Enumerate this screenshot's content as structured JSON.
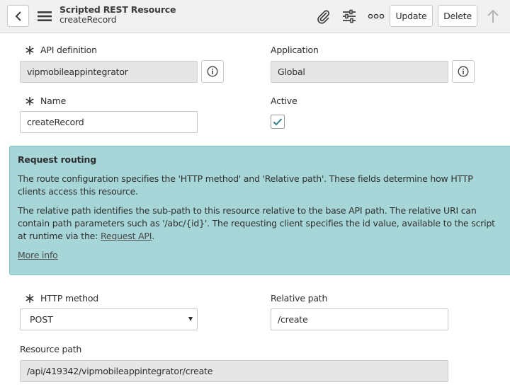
{
  "header": {
    "title": "Scripted REST Resource",
    "subtitle": "createRecord",
    "update_label": "Update",
    "delete_label": "Delete"
  },
  "form": {
    "api_definition": {
      "label": "API definition",
      "value": "vipmobileappintegrator"
    },
    "application": {
      "label": "Application",
      "value": "Global"
    },
    "name": {
      "label": "Name",
      "value": "createRecord"
    },
    "active": {
      "label": "Active",
      "checked": true
    }
  },
  "request_routing": {
    "title": "Request routing",
    "para1": "The route configuration specifies the 'HTTP method' and 'Relative path'. These fields determine how HTTP clients access this resource.",
    "para2_text": "The relative path identifies the sub-path to this resource relative to the base API path. The relative URI can contain path parameters such as '/abc/{id}'. The requesting client specifies the id value, available to the script at runtime via the: ",
    "para2_link": "Request API",
    "para2_end": ".",
    "more_info": "More info"
  },
  "routing": {
    "http_method": {
      "label": "HTTP method",
      "value": "POST"
    },
    "relative_path": {
      "label": "Relative path",
      "value": "/create"
    },
    "resource_path": {
      "label": "Resource path",
      "value": "/api/419342/vipmobileappintegrator/create"
    }
  },
  "colors": {
    "header_bg": "#f1f1f1",
    "info_bg": "#a7d6d9",
    "readonly_bg": "#e6e6e6",
    "check": "#2f7e87"
  },
  "icons": [
    "back-arrow-icon",
    "hamburger-menu-icon",
    "paperclip-icon",
    "sliders-icon",
    "more-options-icon",
    "scroll-up-arrow-icon",
    "info-icon",
    "required-asterisk-icon",
    "checkmark-icon",
    "dropdown-caret-icon"
  ]
}
